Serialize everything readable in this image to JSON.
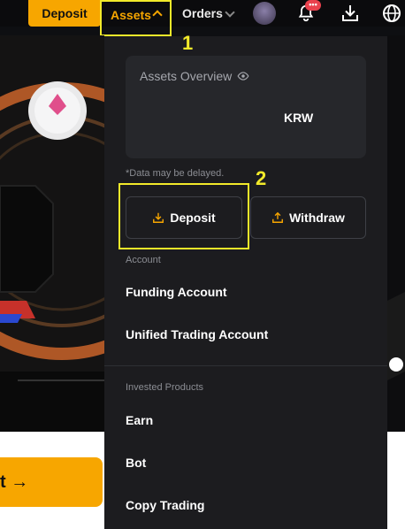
{
  "topbar": {
    "deposit_label": "Deposit",
    "assets_label": "Assets",
    "orders_label": "Orders",
    "notification_badge": "•••"
  },
  "hero": {
    "cta_label": "t →"
  },
  "assets_menu": {
    "overview_title": "Assets Overview",
    "currency": "KRW",
    "delay_note": "*Data may be delayed.",
    "deposit_label": "Deposit",
    "withdraw_label": "Withdraw",
    "account_section": "Account",
    "account_items": [
      "Funding Account",
      "Unified Trading Account"
    ],
    "invested_section": "Invested Products",
    "invested_items": [
      "Earn",
      "Bot",
      "Copy Trading"
    ]
  },
  "annotations": {
    "step_1": "1",
    "step_2": "2"
  },
  "colors": {
    "accent": "#f7a600",
    "highlight": "#f2ea2a",
    "menu_bg": "#1c1c1f",
    "card_bg": "#26272b",
    "badge": "#e9414d"
  },
  "icons": [
    "eye-icon",
    "deposit-icon",
    "withdraw-icon",
    "bell-icon",
    "download-icon",
    "globe-icon",
    "avatar"
  ]
}
